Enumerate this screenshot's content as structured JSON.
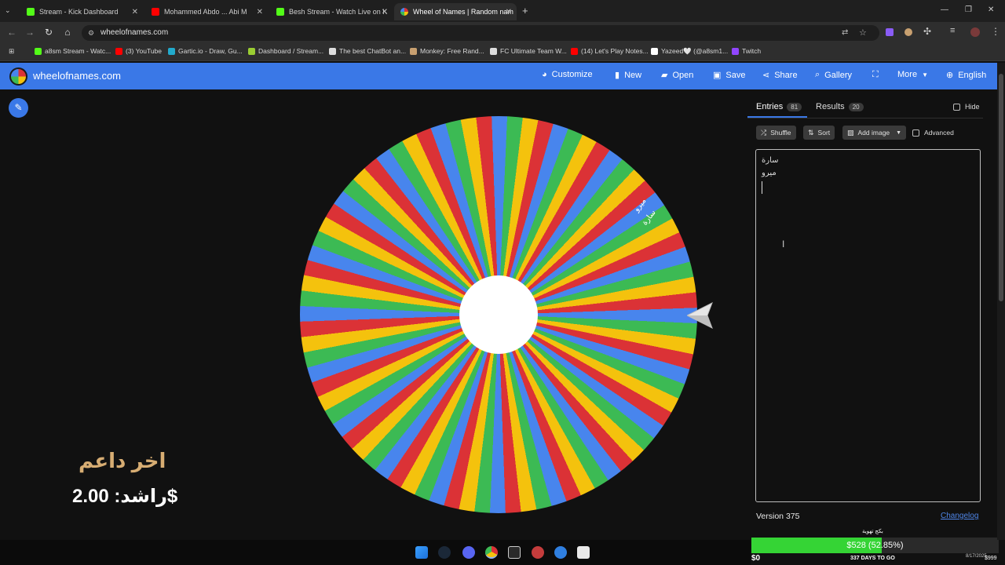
{
  "browser": {
    "tabs": [
      {
        "title": "Stream - Kick Dashboard",
        "color": "#53fc18"
      },
      {
        "title": "Mohammed Abdo ... Abi M",
        "color": "#ff0000"
      },
      {
        "title": "Besh Stream - Watch Live on K",
        "color": "#53fc18"
      },
      {
        "title": "Wheel of Names | Random nam",
        "color": "#4885ed"
      }
    ],
    "new_tab_label": "+",
    "url": "wheelofnames.com",
    "bookmarks": [
      {
        "label": "a8sm Stream - Watc...",
        "color": "#53fc18"
      },
      {
        "label": "(3) YouTube",
        "color": "#ff0000"
      },
      {
        "label": "Gartic.io - Draw, Gu...",
        "color": "#22aacc"
      },
      {
        "label": "Dashboard / Stream...",
        "color": "#9acd32"
      },
      {
        "label": "The best ChatBot an...",
        "color": "#dddddd"
      },
      {
        "label": "Monkey: Free Rand...",
        "color": "#c8a070"
      },
      {
        "label": "FC Ultimate Team W...",
        "color": "#dddddd"
      },
      {
        "label": "(14) Let's Play Notes...",
        "color": "#ff0000"
      },
      {
        "label": "Yazeed🤍 (@a8sm1...",
        "color": "#ffffff"
      },
      {
        "label": "Twitch",
        "color": "#9146ff"
      }
    ]
  },
  "site": {
    "name": "wheelofnames.com",
    "nav": {
      "customize": "Customize",
      "new": "New",
      "open": "Open",
      "save": "Save",
      "share": "Share",
      "gallery": "Gallery",
      "more": "More",
      "language": "English"
    }
  },
  "wheel": {
    "colors": [
      "#4885ed",
      "#3cba54",
      "#f4c20d",
      "#db3236"
    ],
    "slice_count": 80,
    "labels": [
      "ميرو",
      "سارة"
    ]
  },
  "overlay": {
    "title": "اخر داعم",
    "donation": "راشد: 2.00$"
  },
  "panel": {
    "entries_tab": "Entries",
    "entries_count": "81",
    "results_tab": "Results",
    "results_count": "20",
    "hide_label": "Hide",
    "shuffle": "Shuffle",
    "sort": "Sort",
    "add_image": "Add image",
    "advanced": "Advanced",
    "entries": [
      "سارة",
      "ميرو"
    ],
    "version": "Version 375",
    "changelog": "Changelog"
  },
  "goal": {
    "title": "بكج تهوية",
    "amount_text": "$528 (52.85%)",
    "progress": 0.5285,
    "min": "$0",
    "days": "337 DAYS TO GO",
    "date": "8/17/2025",
    "max": "$999",
    "fill_color": "#35d435"
  }
}
